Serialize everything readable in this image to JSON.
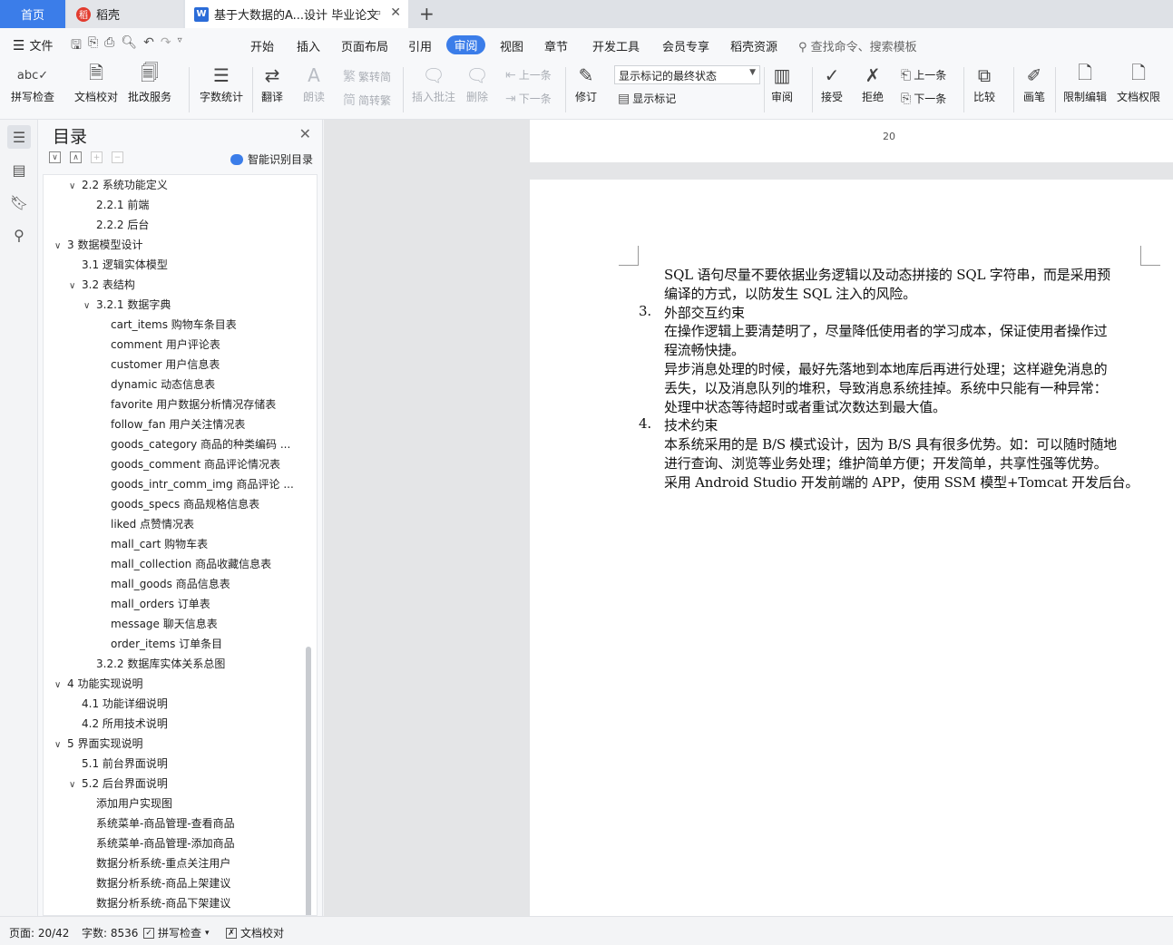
{
  "tabs": {
    "home": "首页",
    "daoke": "稻壳",
    "doc": "基于大数据的A...设计 毕业论文"
  },
  "menu": {
    "file": "文件",
    "items": [
      "开始",
      "插入",
      "页面布局",
      "引用",
      "审阅",
      "视图",
      "章节",
      "开发工具",
      "会员专享",
      "稻壳资源"
    ],
    "active": "审阅",
    "search": "查找命令、搜索模板"
  },
  "ribbon": {
    "spell_check": "拼写检查",
    "doc_proof": "文档校对",
    "review_service": "批改服务",
    "word_count": "字数统计",
    "translate": "翻译",
    "read_aloud": "朗读",
    "trad_to_simp": "繁转简",
    "simp_to_trad": "简转繁",
    "insert_comment": "插入批注",
    "delete": "删除",
    "prev_comment": "上一条",
    "next_comment": "下一条",
    "revise": "修订",
    "markup_state": "显示标记的最终状态",
    "show_markup": "显示标记",
    "review": "审阅",
    "accept": "接受",
    "reject": "拒绝",
    "prev_change": "上一条",
    "next_change": "下一条",
    "compare": "比较",
    "pen": "画笔",
    "restrict_edit": "限制编辑",
    "doc_permission": "文档权限"
  },
  "toc": {
    "title": "目录",
    "smart": "智能识别目录",
    "items": [
      {
        "text": "2.2  系统功能定义",
        "level": 2,
        "arrow": "∨"
      },
      {
        "text": "2.2.1  前端",
        "level": 3,
        "arrow": ""
      },
      {
        "text": "2.2.2  后台",
        "level": 3,
        "arrow": ""
      },
      {
        "text": "3  数据模型设计",
        "level": 1,
        "arrow": "∨"
      },
      {
        "text": "3.1  逻辑实体模型",
        "level": 2,
        "arrow": ""
      },
      {
        "text": "3.2  表结构",
        "level": 2,
        "arrow": "∨"
      },
      {
        "text": "3.2.1 数据字典",
        "level": 3,
        "arrow": "∨"
      },
      {
        "text": "cart_items 购物车条目表",
        "level": 4,
        "arrow": ""
      },
      {
        "text": "comment 用户评论表",
        "level": 4,
        "arrow": ""
      },
      {
        "text": "customer 用户信息表",
        "level": 4,
        "arrow": ""
      },
      {
        "text": "dynamic 动态信息表",
        "level": 4,
        "arrow": ""
      },
      {
        "text": "favorite 用户数据分析情况存储表",
        "level": 4,
        "arrow": ""
      },
      {
        "text": "follow_fan 用户关注情况表",
        "level": 4,
        "arrow": ""
      },
      {
        "text": "goods_category 商品的种类编码 ...",
        "level": 4,
        "arrow": ""
      },
      {
        "text": "goods_comment 商品评论情况表",
        "level": 4,
        "arrow": ""
      },
      {
        "text": "goods_intr_comm_img 商品评论 ...",
        "level": 4,
        "arrow": ""
      },
      {
        "text": "goods_specs 商品规格信息表",
        "level": 4,
        "arrow": ""
      },
      {
        "text": "liked 点赞情况表",
        "level": 4,
        "arrow": ""
      },
      {
        "text": "mall_cart 购物车表",
        "level": 4,
        "arrow": ""
      },
      {
        "text": "mall_collection 商品收藏信息表",
        "level": 4,
        "arrow": ""
      },
      {
        "text": "mall_goods 商品信息表",
        "level": 4,
        "arrow": ""
      },
      {
        "text": "mall_orders 订单表",
        "level": 4,
        "arrow": ""
      },
      {
        "text": "message 聊天信息表",
        "level": 4,
        "arrow": ""
      },
      {
        "text": "order_items 订单条目",
        "level": 4,
        "arrow": ""
      },
      {
        "text": "3.2.2 数据库实体关系总图",
        "level": 3,
        "arrow": ""
      },
      {
        "text": "4  功能实现说明",
        "level": 1,
        "arrow": "∨"
      },
      {
        "text": "4.1  功能详细说明",
        "level": 2,
        "arrow": ""
      },
      {
        "text": "4.2  所用技术说明",
        "level": 2,
        "arrow": ""
      },
      {
        "text": "5  界面实现说明",
        "level": 1,
        "arrow": "∨"
      },
      {
        "text": "5.1 前台界面说明",
        "level": 2,
        "arrow": ""
      },
      {
        "text": "5.2 后台界面说明",
        "level": 2,
        "arrow": "∨"
      },
      {
        "text": "添加用户实现图",
        "level": 3,
        "arrow": ""
      },
      {
        "text": "系统菜单-商品管理-查看商品",
        "level": 3,
        "arrow": ""
      },
      {
        "text": "系统菜单-商品管理-添加商品",
        "level": 3,
        "arrow": ""
      },
      {
        "text": "数据分析系统-重点关注用户",
        "level": 3,
        "arrow": ""
      },
      {
        "text": "数据分析系统-商品上架建议",
        "level": 3,
        "arrow": ""
      },
      {
        "text": "数据分析系统-商品下架建议",
        "level": 3,
        "arrow": ""
      }
    ]
  },
  "document": {
    "page_number": "20",
    "lines": [
      {
        "text": "SQL 语句尽量不要依据业务逻辑以及动态拼接的 SQL 字符串，而是采用预",
        "indent": "body"
      },
      {
        "text": "编译的方式，以防发生 SQL 注入的风险。",
        "indent": "body"
      },
      {
        "text": "外部交互约束",
        "indent": "body",
        "num": "3."
      },
      {
        "text": "在操作逻辑上要清楚明了，尽量降低使用者的学习成本，保证使用者操作过",
        "indent": "body"
      },
      {
        "text": "程流畅快捷。",
        "indent": "body"
      },
      {
        "text": "异步消息处理的时候，最好先落地到本地库后再进行处理；这样避免消息的",
        "indent": "body"
      },
      {
        "text": "丢失，以及消息队列的堆积，导致消息系统挂掉。系统中只能有一种异常：",
        "indent": "body"
      },
      {
        "text": "处理中状态等待超时或者重试次数达到最大值。",
        "indent": "body"
      },
      {
        "text": "技术约束",
        "indent": "body",
        "num": "4."
      },
      {
        "text": "本系统采用的是 B/S 模式设计，因为 B/S 具有很多优势。如：可以随时随地",
        "indent": "body"
      },
      {
        "text": "进行查询、浏览等业务处理；维护简单方便；开发简单，共享性强等优势。",
        "indent": "body"
      },
      {
        "text": "采用 Android Studio 开发前端的 APP，使用 SSM 模型+Tomcat 开发后台。",
        "indent": "body"
      }
    ]
  },
  "status": {
    "page": "页面: 20/42",
    "words": "字数: 8536",
    "spell": "拼写检查",
    "proof": "文档校对"
  }
}
